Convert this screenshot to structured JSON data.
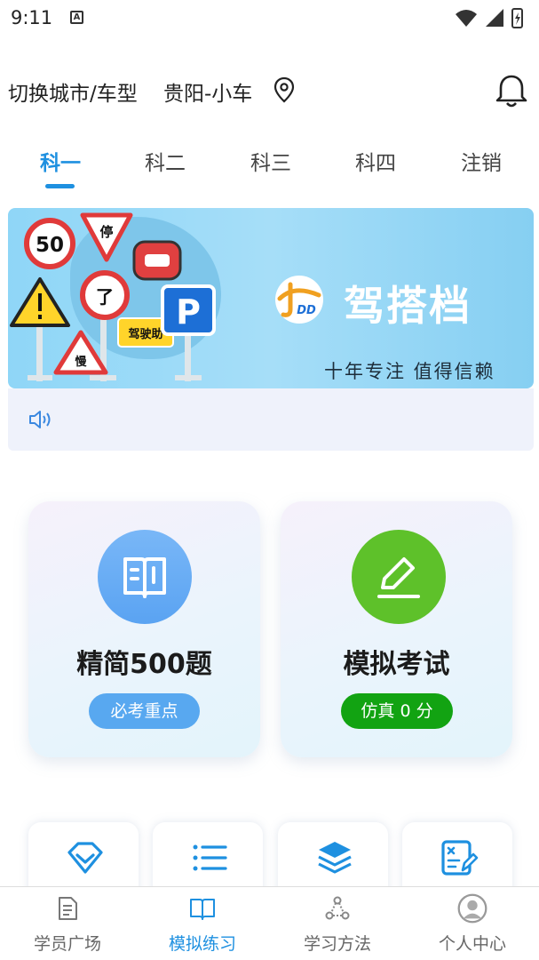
{
  "status_bar": {
    "time": "9:11",
    "notification_icon": "A"
  },
  "header": {
    "switch_label": "切换城市/车型",
    "city_value": "贵阳-小车"
  },
  "tabs": [
    {
      "label": "科一",
      "active": true
    },
    {
      "label": "科二",
      "active": false
    },
    {
      "label": "科三",
      "active": false
    },
    {
      "label": "科四",
      "active": false
    },
    {
      "label": "注销",
      "active": false
    }
  ],
  "banner": {
    "brand_name": "驾搭档",
    "logo_text": "DD",
    "slogan": "十年专注  值得信赖",
    "signs": {
      "speed": "50",
      "stop": "停",
      "turn": "了",
      "slow": "慢",
      "parking": "P",
      "tag": "驾驶助"
    }
  },
  "cards": [
    {
      "title": "精简500题",
      "badge": "必考重点",
      "icon": "book-icon",
      "color": "#5aa3f2"
    },
    {
      "title": "模拟考试",
      "badge": "仿真 0 分",
      "icon": "pencil-icon",
      "color": "#5ec12a"
    }
  ],
  "mini_cards": [
    {
      "icon": "diamond-icon"
    },
    {
      "icon": "list-icon"
    },
    {
      "icon": "layers-icon"
    },
    {
      "icon": "exam-paper-icon"
    }
  ],
  "bottom_nav": [
    {
      "label": "学员广场",
      "icon": "document-icon",
      "active": false
    },
    {
      "label": "模拟练习",
      "icon": "open-book-icon",
      "active": true
    },
    {
      "label": "学习方法",
      "icon": "nodes-icon",
      "active": false
    },
    {
      "label": "个人中心",
      "icon": "user-icon",
      "active": false
    }
  ],
  "colors": {
    "accent": "#1e90e0",
    "card_blue": "#5aa3f2",
    "card_green": "#5ec12a",
    "badge_green": "#12a312"
  }
}
